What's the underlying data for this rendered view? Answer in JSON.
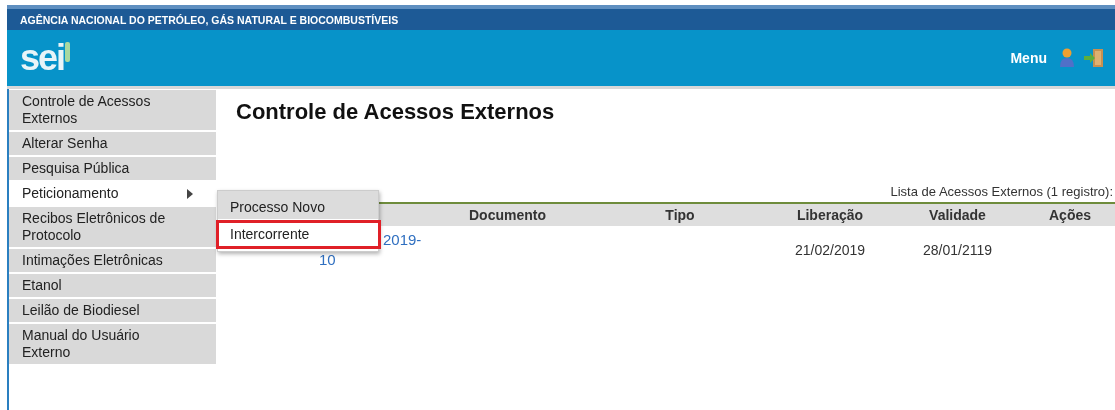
{
  "agency": "AGÊNCIA NACIONAL DO PETRÓLEO, GÁS NATURAL E BIOCOMBUSTÍVEIS",
  "logo": "sei",
  "menu_label": "Menu",
  "sidebar": {
    "items": [
      {
        "label": "Controle de Acessos Externos",
        "selected": false,
        "has_submenu": false
      },
      {
        "label": "Alterar Senha",
        "selected": false,
        "has_submenu": false
      },
      {
        "label": "Pesquisa Pública",
        "selected": false,
        "has_submenu": false
      },
      {
        "label": "Peticionamento",
        "selected": true,
        "has_submenu": true
      },
      {
        "label": "Recibos Eletrônicos de Protocolo",
        "selected": false,
        "has_submenu": false
      },
      {
        "label": "Intimações Eletrônicas",
        "selected": false,
        "has_submenu": false
      },
      {
        "label": "Etanol",
        "selected": false,
        "has_submenu": false
      },
      {
        "label": "Leilão de Biodiesel",
        "selected": false,
        "has_submenu": false
      },
      {
        "label": "Manual do Usuário Externo",
        "selected": false,
        "has_submenu": false
      }
    ]
  },
  "submenu": [
    {
      "label": "Processo Novo",
      "highlighted": false
    },
    {
      "label": "Intercorrente",
      "highlighted": true
    }
  ],
  "page_title": "Controle de Acessos Externos",
  "table": {
    "caption": "Lista de Acessos Externos (1 registro):",
    "columns": [
      "Documento",
      "Tipo",
      "Liberação",
      "Validade",
      "Ações"
    ],
    "rows": [
      {
        "processo": "2019-10",
        "liberacao": "21/02/2019",
        "validade": "28/01/2119"
      }
    ]
  }
}
